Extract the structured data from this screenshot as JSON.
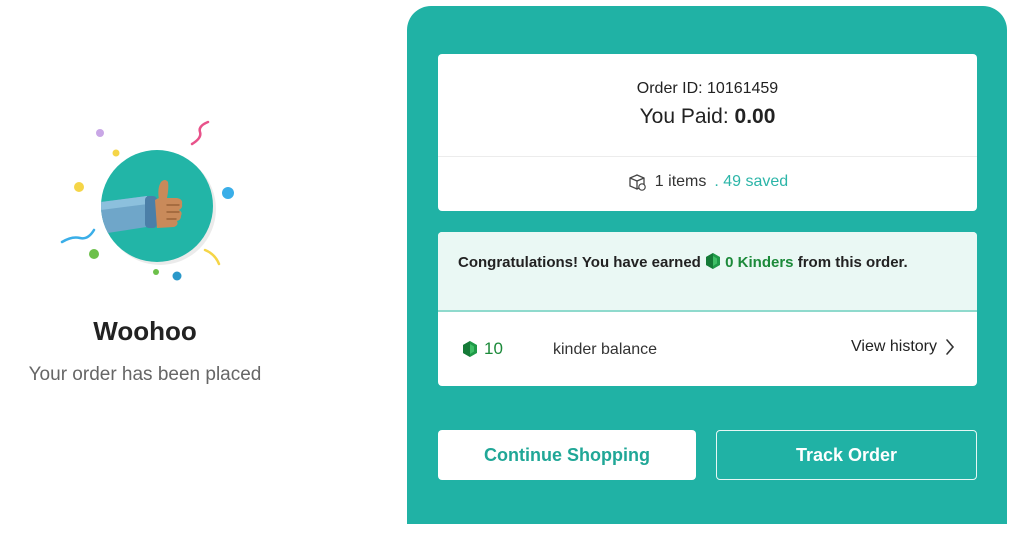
{
  "confirmation": {
    "heading": "Woohoo",
    "subtext": "Your order has been placed"
  },
  "order": {
    "order_id_label": "Order ID: 10161459",
    "paid_label": "You Paid: ",
    "paid_amount": "0.00",
    "items_text": "1 items",
    "saved_text": ". 49 saved"
  },
  "kinders": {
    "congrats_prefix": "Congratulations! You have earned",
    "earned_text": "0 Kinders",
    "congrats_suffix": "from this order.",
    "balance_value": "10",
    "balance_label": "kinder balance",
    "view_history_label": "View history"
  },
  "actions": {
    "continue_label": "Continue Shopping",
    "track_label": "Track Order"
  },
  "icons": {
    "thumbs_up": "thumbs-up-icon",
    "package": "package-icon",
    "kinder_gem": "kinder-gem-icon",
    "chevron": "chevron-right-icon"
  },
  "colors": {
    "panel": "#20b2a5",
    "accent_text": "#20a797",
    "kinder_green": "#1c8a3a",
    "saved_teal": "#2cb5a8",
    "congrats_bg": "#eaf8f4"
  }
}
